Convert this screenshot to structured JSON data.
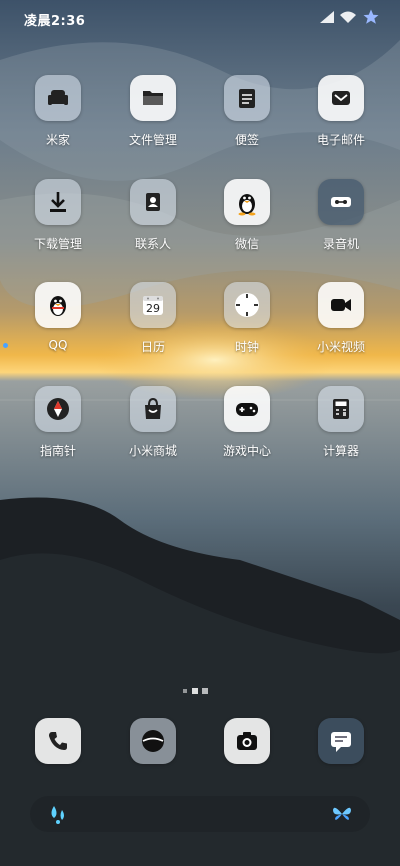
{
  "status_bar": {
    "time": "凌晨2:36"
  },
  "rows": [
    [
      {
        "label": "米家",
        "icon": "mijia-icon"
      },
      {
        "label": "文件管理",
        "icon": "folder-icon"
      },
      {
        "label": "便签",
        "icon": "notes-icon"
      },
      {
        "label": "电子邮件",
        "icon": "mail-icon"
      }
    ],
    [
      {
        "label": "下载管理",
        "icon": "download-icon"
      },
      {
        "label": "联系人",
        "icon": "contacts-icon"
      },
      {
        "label": "微信",
        "icon": "penguin-icon"
      },
      {
        "label": "录音机",
        "icon": "recorder-icon"
      }
    ],
    [
      {
        "label": "QQ",
        "icon": "qq-icon"
      },
      {
        "label": "日历",
        "icon": "calendar-icon",
        "value": "29"
      },
      {
        "label": "时钟",
        "icon": "clock-icon"
      },
      {
        "label": "小米视频",
        "icon": "video-icon"
      }
    ],
    [
      {
        "label": "指南针",
        "icon": "compass-icon"
      },
      {
        "label": "小米商城",
        "icon": "store-icon"
      },
      {
        "label": "游戏中心",
        "icon": "gamepad-icon"
      },
      {
        "label": "计算器",
        "icon": "calculator-icon"
      }
    ]
  ],
  "dock": [
    {
      "icon": "phone-icon"
    },
    {
      "icon": "browser-icon"
    },
    {
      "icon": "camera-icon"
    },
    {
      "icon": "messages-icon"
    }
  ],
  "bottom": [
    {
      "icon": "water-drop-icon"
    },
    {
      "icon": "butterfly-icon"
    }
  ],
  "colors": {
    "accent": "#4aa3ff",
    "icon_bg": "#ffffff"
  }
}
